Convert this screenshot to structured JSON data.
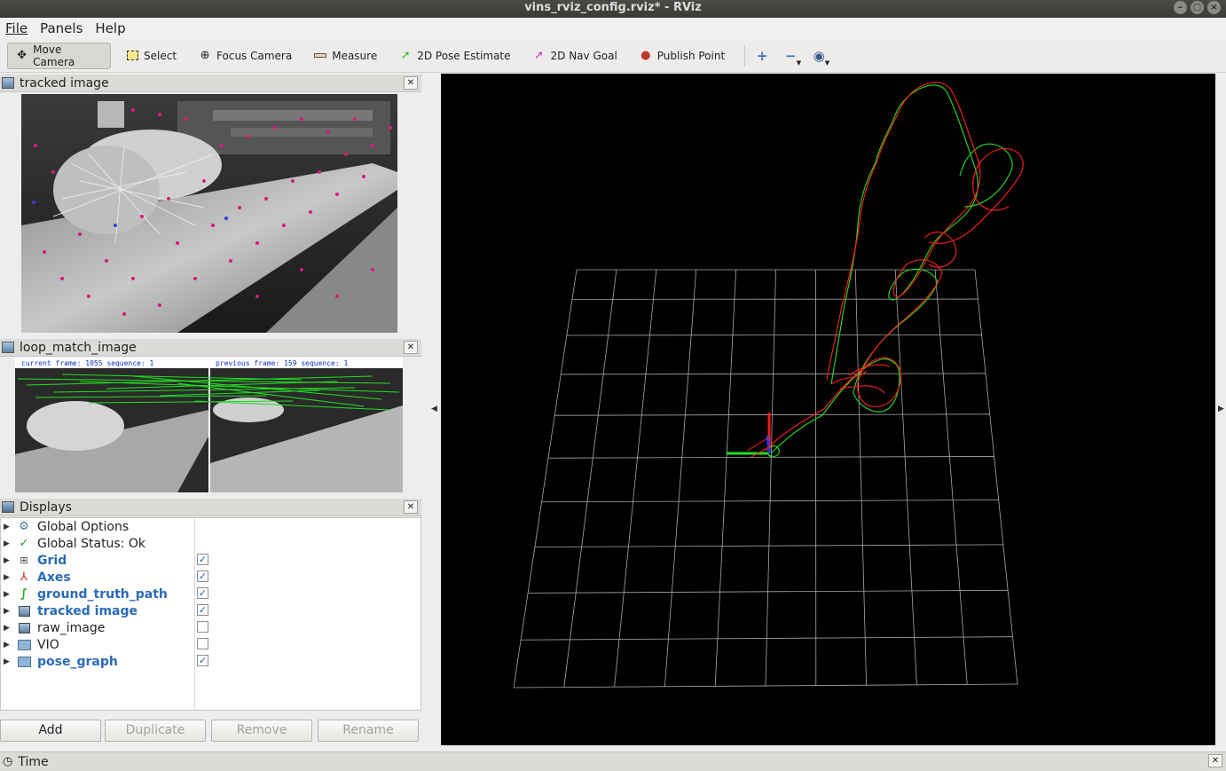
{
  "window": {
    "title": "vins_rviz_config.rviz* - RViz"
  },
  "menu": {
    "file": "File",
    "panels": "Panels",
    "help": "Help"
  },
  "toolbar": {
    "move_camera": "Move Camera",
    "select": "Select",
    "focus_camera": "Focus Camera",
    "measure": "Measure",
    "pose_estimate": "2D Pose Estimate",
    "nav_goal": "2D Nav Goal",
    "publish_point": "Publish Point"
  },
  "panels": {
    "tracked_image": {
      "title": "tracked image"
    },
    "loop_match": {
      "title": "loop_match_image",
      "current_text": "current frame: 1055   sequence: 1",
      "previous_text": "previous frame: 159   sequence: 1"
    },
    "displays": {
      "title": "Displays",
      "items": [
        {
          "label": "Global Options",
          "icon": "gear-icon",
          "enabled": false,
          "checkbox": null
        },
        {
          "label": "Global Status: Ok",
          "icon": "check-icon",
          "enabled": false,
          "checkbox": null
        },
        {
          "label": "Grid",
          "icon": "grid-icon",
          "enabled": true,
          "checkbox": true
        },
        {
          "label": "Axes",
          "icon": "axes-icon",
          "enabled": true,
          "checkbox": true
        },
        {
          "label": "ground_truth_path",
          "icon": "path-icon",
          "enabled": true,
          "checkbox": true
        },
        {
          "label": "tracked image",
          "icon": "image-icon",
          "enabled": true,
          "checkbox": true
        },
        {
          "label": "raw_image",
          "icon": "image-icon",
          "enabled": false,
          "checkbox": false
        },
        {
          "label": "VIO",
          "icon": "folder-icon",
          "enabled": false,
          "checkbox": false
        },
        {
          "label": "pose_graph",
          "icon": "folder-icon",
          "enabled": true,
          "checkbox": true
        }
      ]
    },
    "buttons": {
      "add": "Add",
      "duplicate": "Duplicate",
      "remove": "Remove",
      "rename": "Rename"
    },
    "time": {
      "title": "Time"
    }
  },
  "colors": {
    "viewport_bg": "#000000",
    "grid": "#a0a0a0",
    "path_red": "#ff2020",
    "path_green": "#22e022",
    "enabled_label": "#2a6bb4"
  }
}
